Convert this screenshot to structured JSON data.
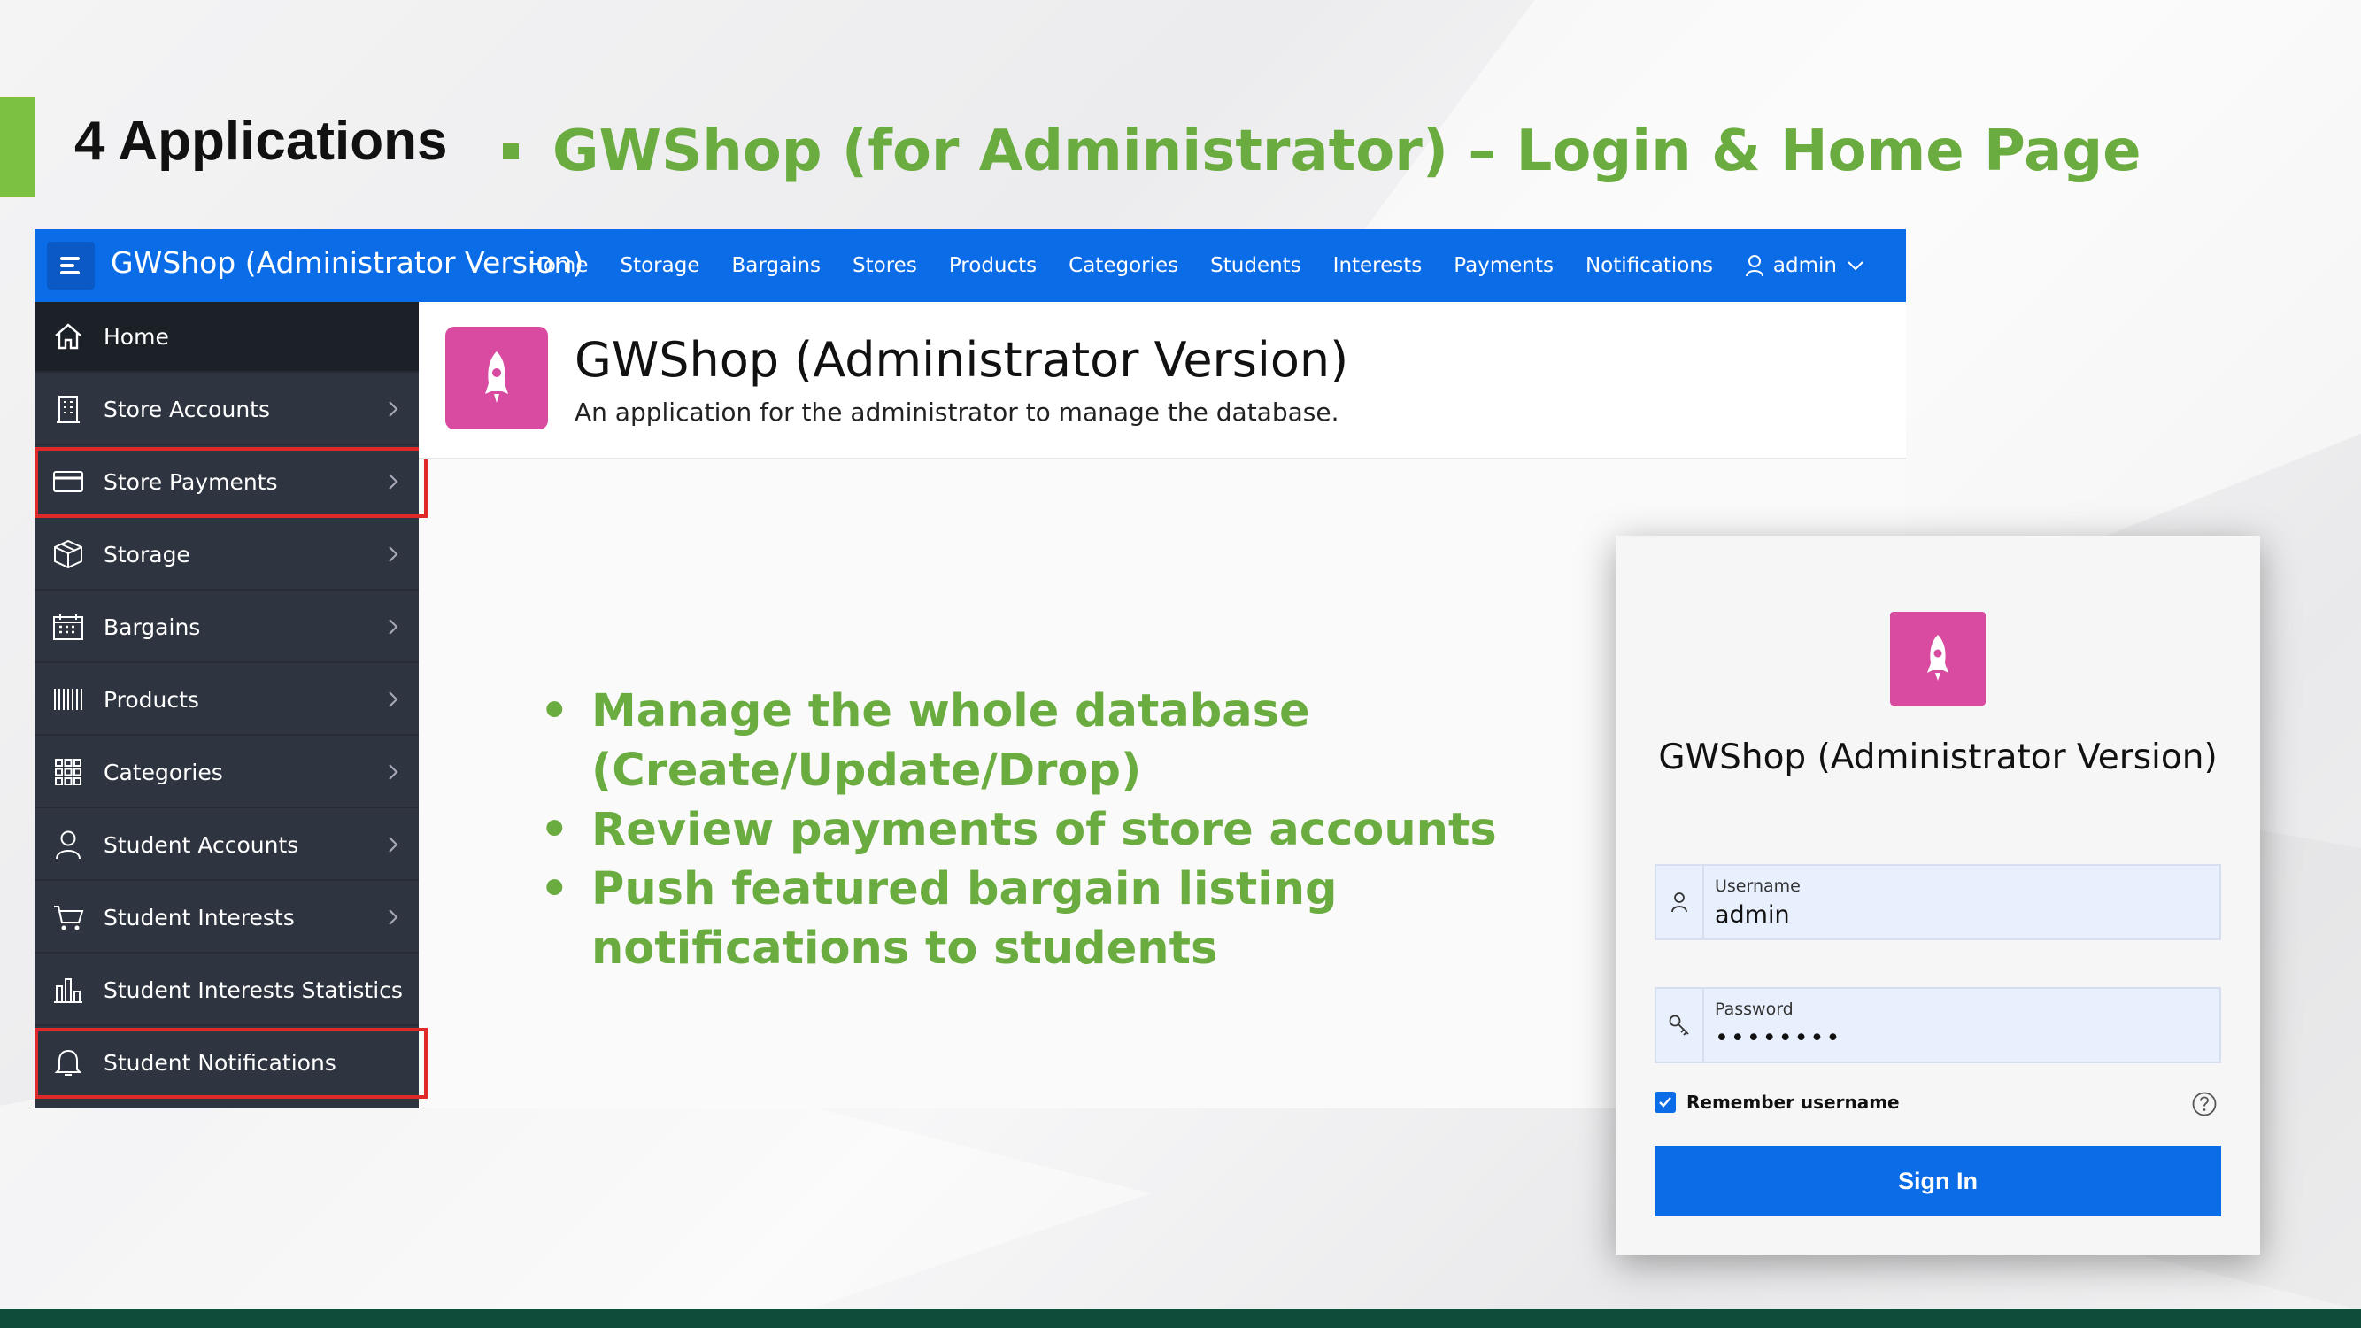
{
  "slide": {
    "section_title": "4 Applications",
    "headline": "GWShop (for Administrator) – Login & Home Page",
    "accent_color": "#7dc142",
    "headline_color": "#6aac3f"
  },
  "app": {
    "name": "GWShop (Administrator Version)",
    "brand_color": "#0b6ce8",
    "topnav": [
      "Home",
      "Storage",
      "Bargains",
      "Stores",
      "Products",
      "Categories",
      "Students",
      "Interests",
      "Payments",
      "Notifications"
    ],
    "user": "admin",
    "sidebar": [
      {
        "label": "Home",
        "icon": "home-icon",
        "active": true,
        "chevron": false,
        "highlighted": false
      },
      {
        "label": "Store Accounts",
        "icon": "building-icon",
        "active": false,
        "chevron": true,
        "highlighted": false
      },
      {
        "label": "Store Payments",
        "icon": "credit-card-icon",
        "active": false,
        "chevron": true,
        "highlighted": true
      },
      {
        "label": "Storage",
        "icon": "box-icon",
        "active": false,
        "chevron": true,
        "highlighted": false
      },
      {
        "label": "Bargains",
        "icon": "calendar-icon",
        "active": false,
        "chevron": true,
        "highlighted": false
      },
      {
        "label": "Products",
        "icon": "barcode-icon",
        "active": false,
        "chevron": true,
        "highlighted": false
      },
      {
        "label": "Categories",
        "icon": "grid-icon",
        "active": false,
        "chevron": true,
        "highlighted": false
      },
      {
        "label": "Student Accounts",
        "icon": "user-icon",
        "active": false,
        "chevron": true,
        "highlighted": false
      },
      {
        "label": "Student Interests",
        "icon": "cart-icon",
        "active": false,
        "chevron": true,
        "highlighted": false
      },
      {
        "label": "Student Interests Statistics",
        "icon": "bar-chart-icon",
        "active": false,
        "chevron": false,
        "highlighted": false
      },
      {
        "label": "Student Notifications",
        "icon": "bell-icon",
        "active": false,
        "chevron": false,
        "highlighted": true
      }
    ],
    "content": {
      "title": "GWShop (Administrator Version)",
      "subtitle": "An application for the administrator to manage the database."
    }
  },
  "bullets": [
    "Manage the whole database (Create/Update/Drop)",
    "Review payments of store accounts",
    "Push featured bargain listing notifications to students"
  ],
  "login": {
    "title": "GWShop (Administrator Version)",
    "username_label": "Username",
    "username_value": "admin",
    "password_label": "Password",
    "password_value": "••••••••",
    "remember_label": "Remember username",
    "remember_checked": true,
    "signin_label": "Sign In"
  }
}
